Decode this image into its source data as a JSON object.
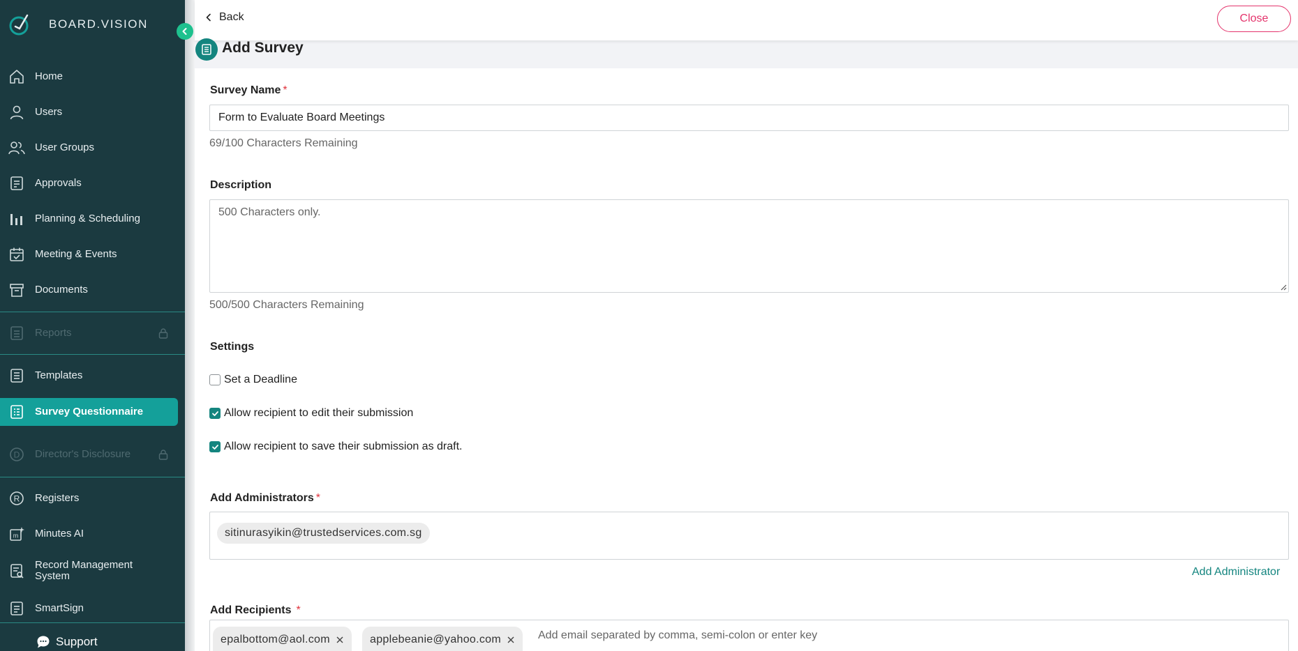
{
  "brand": {
    "name": "BOARD.VISION"
  },
  "sidebar": {
    "items": [
      {
        "label": "Home",
        "icon": "home-icon"
      },
      {
        "label": "Users",
        "icon": "user-icon"
      },
      {
        "label": "User Groups",
        "icon": "users-icon"
      },
      {
        "label": "Approvals",
        "icon": "approvals-icon"
      },
      {
        "label": "Planning & Scheduling",
        "icon": "bar-chart-icon"
      },
      {
        "label": "Meeting & Events",
        "icon": "calendar-check-icon"
      },
      {
        "label": "Documents",
        "icon": "archive-icon"
      },
      {
        "label": "Reports",
        "icon": "report-icon",
        "locked": true
      },
      {
        "label": "Templates",
        "icon": "template-icon"
      },
      {
        "label": "Survey Questionnaire",
        "icon": "survey-icon",
        "active": true
      },
      {
        "label": "Director's Disclosure",
        "icon": "disclosure-icon",
        "locked": true
      },
      {
        "label": "Registers",
        "icon": "registered-icon"
      },
      {
        "label": "Minutes AI",
        "icon": "minutes-ai-icon"
      },
      {
        "label": "Record Management System",
        "icon": "record-icon"
      },
      {
        "label": "SmartSign",
        "icon": "smartsign-icon"
      }
    ],
    "support_label": "Support"
  },
  "topbar": {
    "back_label": "Back",
    "close_label": "Close"
  },
  "page": {
    "title": "Add Survey"
  },
  "form": {
    "survey_name": {
      "label": "Survey Name",
      "required": "*",
      "value": "Form to Evaluate Board Meetings",
      "hint": "69/100 Characters Remaining"
    },
    "description": {
      "label": "Description",
      "placeholder": "500 Characters only.",
      "hint": "500/500 Characters Remaining"
    },
    "settings": {
      "label": "Settings",
      "options": [
        {
          "label": "Set a Deadline",
          "checked": false
        },
        {
          "label": "Allow recipient to edit their submission",
          "checked": true
        },
        {
          "label": "Allow recipient to save their submission as draft.",
          "checked": true
        }
      ]
    },
    "administrators": {
      "label": "Add Administrators",
      "required": "*",
      "chips": [
        "sitinurasyikin@trustedservices.com.sg"
      ],
      "add_link": "Add Administrator"
    },
    "recipients": {
      "label": "Add Recipients",
      "required": "*",
      "chips": [
        "epalbottom@aol.com",
        "applebeanie@yahoo.com"
      ],
      "placeholder": "Add email separated by comma, semi-colon or enter key"
    }
  },
  "colors": {
    "sidebar_bg": "#1b3a40",
    "accent": "#14857f",
    "active_bg": "#14a09a",
    "danger": "#e4346c"
  }
}
